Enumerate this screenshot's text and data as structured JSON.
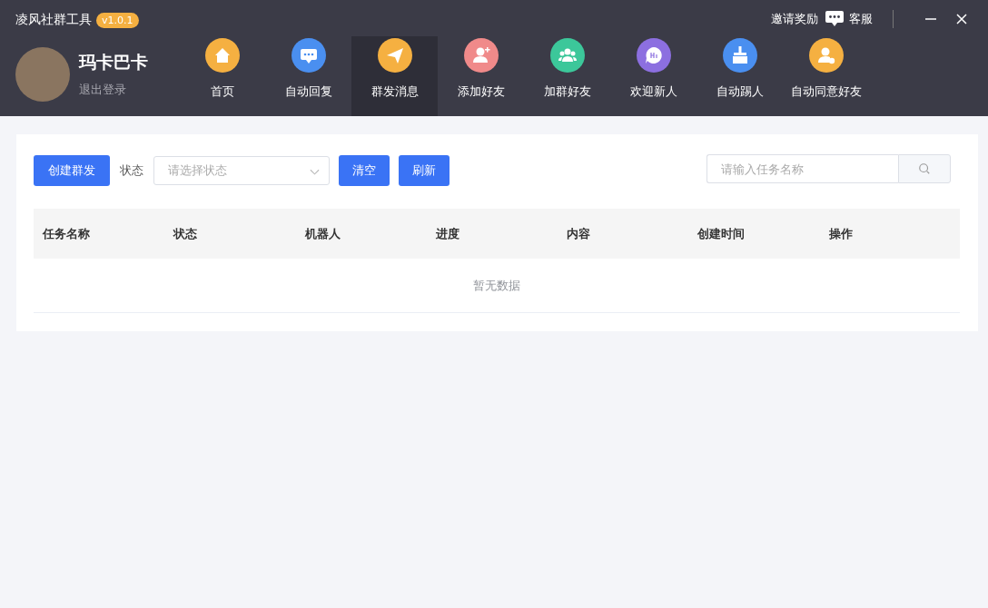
{
  "app": {
    "title": "凌风社群工具",
    "version": "v1.0.1"
  },
  "user": {
    "name": "玛卡巴卡",
    "logout": "退出登录"
  },
  "top_links": [
    {
      "kind": "text",
      "label": "邀请奖励"
    },
    {
      "kind": "chat",
      "label": "客服"
    }
  ],
  "nav": [
    {
      "label": "首页",
      "kind": "home",
      "color": "#f5b041",
      "selected": false
    },
    {
      "label": "自动回复",
      "kind": "chat",
      "color": "#4a8ff0",
      "selected": false
    },
    {
      "label": "群发消息",
      "kind": "send",
      "color": "#f5b041",
      "selected": true
    },
    {
      "label": "添加好友",
      "kind": "adduser",
      "color": "#f08a8a",
      "selected": false
    },
    {
      "label": "加群好友",
      "kind": "group",
      "color": "#3cc79a",
      "selected": false
    },
    {
      "label": "欢迎新人",
      "kind": "hi",
      "color": "#8c6fe0",
      "selected": false
    },
    {
      "label": "自动踢人",
      "kind": "broom",
      "color": "#4a8ff0",
      "selected": false
    },
    {
      "label": "自动同意好友",
      "kind": "agree",
      "color": "#f5b041",
      "selected": false
    }
  ],
  "toolbar": {
    "create": "创建群发",
    "status_label": "状态",
    "status_placeholder": "请选择状态",
    "clear": "清空",
    "refresh": "刷新",
    "search_placeholder": "请输入任务名称"
  },
  "table": {
    "columns": [
      "任务名称",
      "状态",
      "机器人",
      "进度",
      "内容",
      "创建时间",
      "操作"
    ],
    "empty": "暂无数据"
  }
}
